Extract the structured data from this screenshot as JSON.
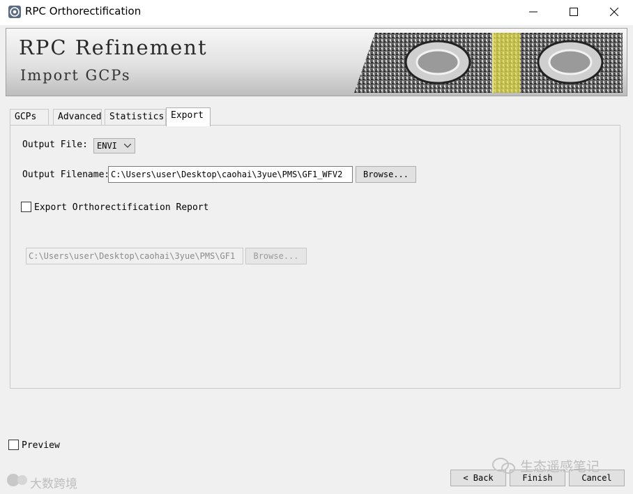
{
  "window": {
    "title": "RPC Orthorectification",
    "icons": [
      "app-icon",
      "minimize-icon",
      "maximize-icon",
      "close-icon"
    ]
  },
  "banner": {
    "title": "RPC Refinement",
    "subtitle": "Import GCPs"
  },
  "tabs": [
    {
      "label": "GCPs",
      "active": false
    },
    {
      "label": "Advanced",
      "active": false
    },
    {
      "label": "Statistics",
      "active": false
    },
    {
      "label": "Export",
      "active": true
    }
  ],
  "export": {
    "output_file_label": "Output File:",
    "output_file_value": "ENVI",
    "output_filename_label": "Output Filename:",
    "output_filename_value": "C:\\Users\\user\\Desktop\\caohai\\3yue\\PMS\\GF1_WFV2",
    "browse_label": "Browse...",
    "report_checkbox_label": "Export Orthorectification Report",
    "report_checked": false,
    "report_path_value": "C:\\Users\\user\\Desktop\\caohai\\3yue\\PMS\\GF1",
    "report_browse_label": "Browse..."
  },
  "footer": {
    "preview_label": "Preview",
    "preview_checked": false,
    "back_label": "< Back",
    "finish_label": "Finish",
    "cancel_label": "Cancel"
  },
  "watermarks": {
    "left": "大数跨境",
    "right": "生态遥感笔记"
  },
  "colors": {
    "banner_highlight": "#e6e04a",
    "window_bg": "#f0f0f0"
  }
}
